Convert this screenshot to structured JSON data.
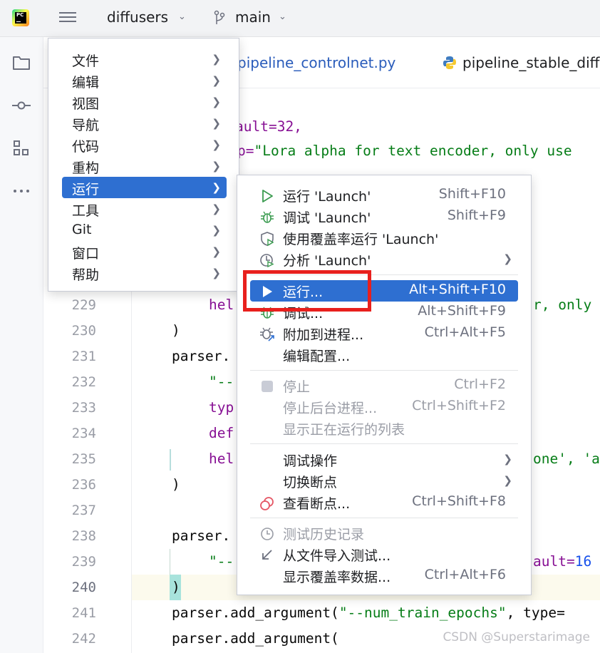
{
  "titlebar": {
    "project": "diffusers",
    "branch": "main"
  },
  "tabs": [
    {
      "label": "pipeline_controlnet.py"
    },
    {
      "label": "pipeline_stable_diff"
    }
  ],
  "editor": {
    "top_fragments": {
      "line_a": "ault=32,",
      "line_b_prefix": "p=",
      "line_b_string": "\"Lora alpha for text encoder, only use"
    },
    "lines": [
      {
        "no": "229",
        "text": "hel",
        "tail": "r, only u"
      },
      {
        "no": "230",
        "text": ")",
        "tail": ""
      },
      {
        "no": "231",
        "text": "parser.",
        "tail": ""
      },
      {
        "no": "232",
        "text": "\"--",
        "tail": ""
      },
      {
        "no": "233",
        "text": "typ",
        "tail": ""
      },
      {
        "no": "234",
        "text": "def",
        "tail": ""
      },
      {
        "no": "235",
        "text": "hel",
        "tail": "one', 'a"
      },
      {
        "no": "236",
        "text": ")",
        "tail": ""
      },
      {
        "no": "237",
        "text": "",
        "tail": ""
      },
      {
        "no": "238",
        "text": "parser.",
        "tail": ""
      },
      {
        "no": "239",
        "text": "\"--",
        "tail": "ault=16"
      },
      {
        "no": "240",
        "text": ")",
        "tail": ""
      },
      {
        "no": "241",
        "text": "parser.add_argument(",
        "string": "\"--num_train_epochs\"",
        "after": ", type="
      },
      {
        "no": "242",
        "text": "parser.add_argument(",
        "tail": ""
      }
    ]
  },
  "main_menu": {
    "items": [
      {
        "label": "文件"
      },
      {
        "label": "编辑"
      },
      {
        "label": "视图"
      },
      {
        "label": "导航"
      },
      {
        "label": "代码"
      },
      {
        "label": "重构"
      },
      {
        "label": "运行"
      },
      {
        "label": "工具"
      },
      {
        "label": "Git"
      },
      {
        "label": "窗口"
      },
      {
        "label": "帮助"
      }
    ],
    "selected_label": "运行"
  },
  "run_menu": {
    "items": [
      {
        "label": "运行 'Launch'",
        "shortcut": "Shift+F10",
        "icon": "run-icon"
      },
      {
        "label": "调试 'Launch'",
        "shortcut": "Shift+F9",
        "icon": "debug-icon"
      },
      {
        "label": "使用覆盖率运行 'Launch'",
        "shortcut": "",
        "icon": "coverage-icon"
      },
      {
        "label": "分析 'Launch'",
        "shortcut": "",
        "icon": "profile-icon"
      },
      {
        "label": "运行...",
        "shortcut": "Alt+Shift+F10",
        "icon": "run-icon"
      },
      {
        "label": "调试...",
        "shortcut": "Alt+Shift+F9",
        "icon": "debug-icon"
      },
      {
        "label": "附加到进程...",
        "shortcut": "Ctrl+Alt+F5",
        "icon": "attach-icon"
      },
      {
        "label": "编辑配置...",
        "shortcut": "",
        "icon": ""
      },
      {
        "label": "停止",
        "shortcut": "Ctrl+F2",
        "icon": "stop-icon"
      },
      {
        "label": "停止后台进程...",
        "shortcut": "Ctrl+Shift+F2",
        "icon": ""
      },
      {
        "label": "显示正在运行的列表",
        "shortcut": "",
        "icon": ""
      },
      {
        "label": "调试操作",
        "shortcut": "",
        "icon": ""
      },
      {
        "label": "切换断点",
        "shortcut": "",
        "icon": ""
      },
      {
        "label": "查看断点...",
        "shortcut": "Ctrl+Shift+F8",
        "icon": "breakpoints-icon"
      },
      {
        "label": "测试历史记录",
        "shortcut": "",
        "icon": "history-icon"
      },
      {
        "label": "从文件导入测试...",
        "shortcut": "",
        "icon": "import-icon"
      },
      {
        "label": "显示覆盖率数据...",
        "shortcut": "Ctrl+Alt+F6",
        "icon": ""
      }
    ]
  },
  "colors": {
    "selection": "#2e6fd1",
    "highlight_box": "#e8201d",
    "keyword": "#871094",
    "string": "#067d17"
  },
  "watermark": "CSDN @Superstarimage"
}
